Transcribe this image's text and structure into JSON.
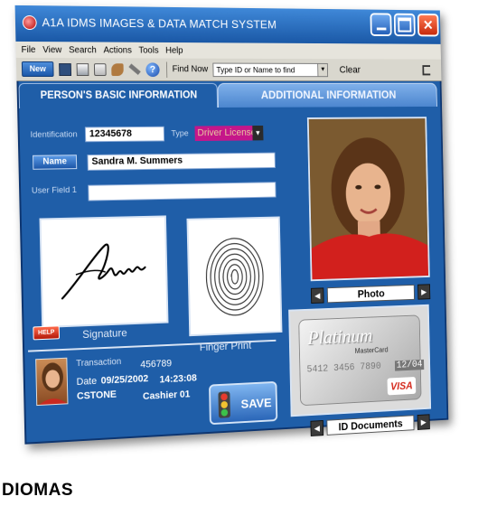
{
  "window": {
    "title": "A1A IDMS IMAGES & DATA MATCH SYSTEM",
    "minimize_icon": "minimize-icon",
    "maximize_icon": "maximize-icon",
    "close_icon": "close-icon",
    "close_glyph": "✕"
  },
  "menu": [
    "File",
    "View",
    "Search",
    "Actions",
    "Tools",
    "Help"
  ],
  "toolbar": {
    "new_label": "New",
    "help_glyph": "?",
    "find_label": "Find Now",
    "find_placeholder": "Type ID or Name  to find",
    "clear_label": "Clear"
  },
  "tabs": {
    "basic": "PERSON'S BASIC INFORMATION",
    "additional": "ADDITIONAL INFORMATION"
  },
  "form": {
    "identification_label": "Identification",
    "identification_value": "12345678",
    "type_label": "Type",
    "type_value": "Driver License",
    "name_button": "Name",
    "name_value": "Sandra M. Summers",
    "user_field_label": "User Field 1",
    "user_field_value": ""
  },
  "signature": {
    "help_label": "HELP",
    "caption": "Signature"
  },
  "fingerprint": {
    "caption": "Finger Print"
  },
  "photo": {
    "label": "Photo",
    "prev_glyph": "◀",
    "next_glyph": "▶"
  },
  "id_docs": {
    "label": "ID Documents",
    "card_brand": "Platinum",
    "card_sub": "MasterCard",
    "card_number": "5412 3456 7890",
    "card_exp": "12/04",
    "card_network": "VISA"
  },
  "transaction": {
    "label": "Transaction",
    "number": "456789",
    "date_label": "Date",
    "date": "09/25/2002",
    "time": "14:23:08",
    "user": "CSTONE",
    "station": "Cashier 01"
  },
  "save_label": "SAVE",
  "footer_text": "DIOMAS"
}
